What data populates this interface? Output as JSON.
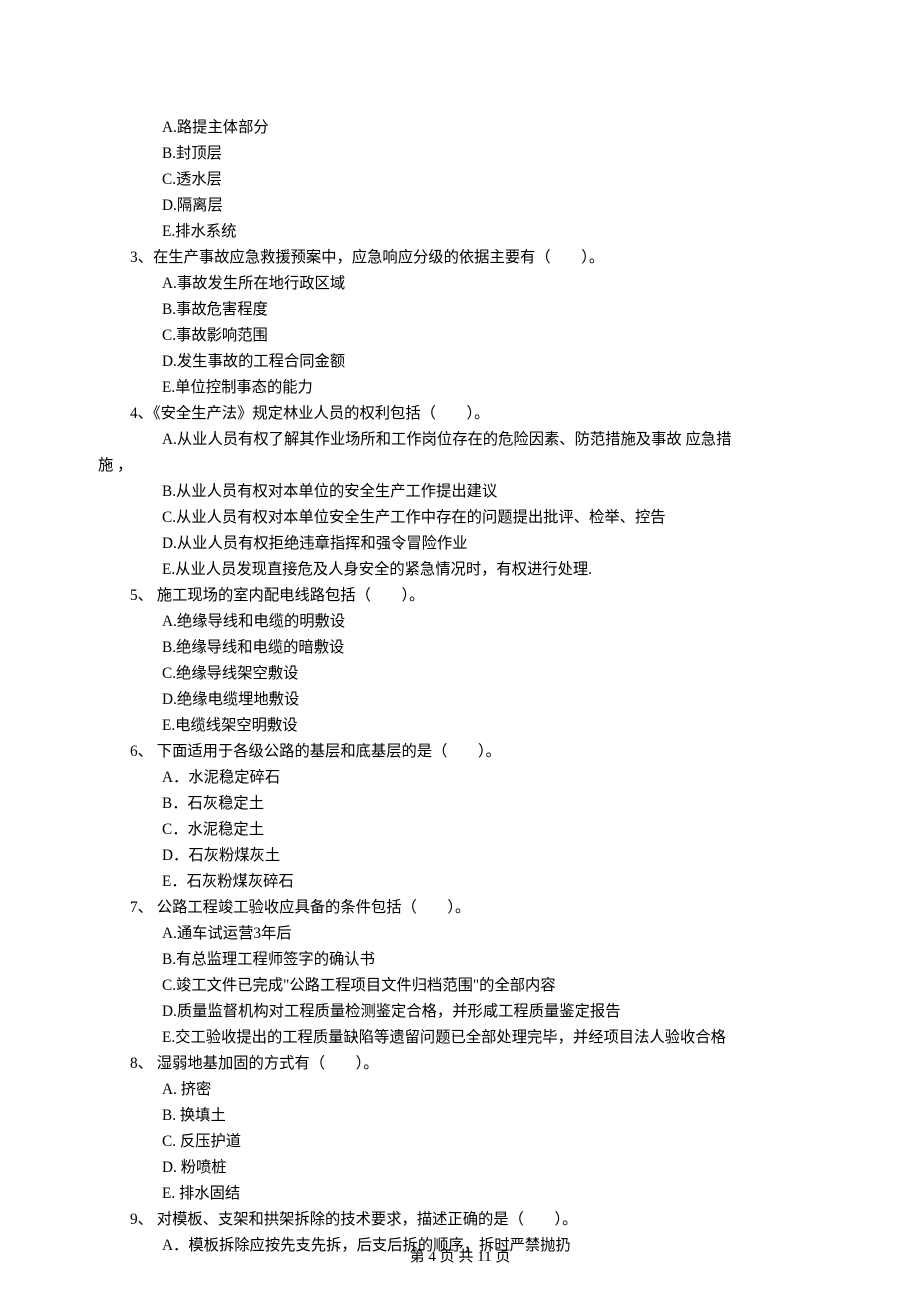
{
  "orphan_options": {
    "A": "路提主体部分",
    "B": "封顶层",
    "C": "透水层",
    "D": "隔离层",
    "E": "排水系统"
  },
  "q3": {
    "stem": "3、在生产事故应急救援预案中，应急响应分级的依据主要有（　　）。",
    "A": "事故发生所在地行政区域",
    "B": "事故危害程度",
    "C": "事故影响范围",
    "D": "发生事故的工程合同金额",
    "E": "单位控制事态的能力"
  },
  "q4": {
    "stem": "4、《安全生产法》规定林业人员的权利包括（　　）。",
    "A_line1": "A.从业人员有权了解其作业场所和工作岗位存在的危险因素、防范措施及事故 应急措",
    "A_line2": "施 ，",
    "B": "从业人员有权对本单位的安全生产工作提出建议",
    "C": "从业人员有权对本单位安全生产工作中存在的问题提出批评、检举、控告",
    "D": "从业人员有权拒绝违章指挥和强令冒险作业",
    "E": "从业人员发现直接危及人身安全的紧急情况时，有权进行处理."
  },
  "q5": {
    "stem": "5、 施工现场的室内配电线路包括（　　）。",
    "A": "绝缘导线和电缆的明敷设",
    "B": "绝缘导线和电缆的暗敷设",
    "C": "绝缘导线架空敷设",
    "D": "绝缘电缆埋地敷设",
    "E": "电缆线架空明敷设"
  },
  "q6": {
    "stem": "6、 下面适用于各级公路的基层和底基层的是（　　）。",
    "A": "水泥稳定碎石",
    "B": "石灰稳定土",
    "C": "水泥稳定土",
    "D": "石灰粉煤灰土",
    "E": "石灰粉煤灰碎石"
  },
  "q7": {
    "stem": "7、 公路工程竣工验收应具备的条件包括（　　）。",
    "A": "通车试运营3年后",
    "B": "有总监理工程师签字的确认书",
    "C": "竣工文件已完成\"公路工程项目文件归档范围\"的全部内容",
    "D": "质量监督机构对工程质量检测鉴定合格，并形咸工程质量鉴定报告",
    "E": "交工验收提出的工程质量缺陷等遗留问题已全部处理完毕，并经项目法人验收合格"
  },
  "q8": {
    "stem": "8、 湿弱地基加固的方式有（　　）。",
    "A": "挤密",
    "B": "换填土",
    "C": "反压护道",
    "D": "粉喷桩",
    "E": "排水固结"
  },
  "q9": {
    "stem": "9、 对模板、支架和拱架拆除的技术要求，描述正确的是（　　）。",
    "A": "模板拆除应按先支先拆，后支后拆的顺序，拆时严禁抛扔"
  },
  "footer": "第 4 页 共 11 页"
}
